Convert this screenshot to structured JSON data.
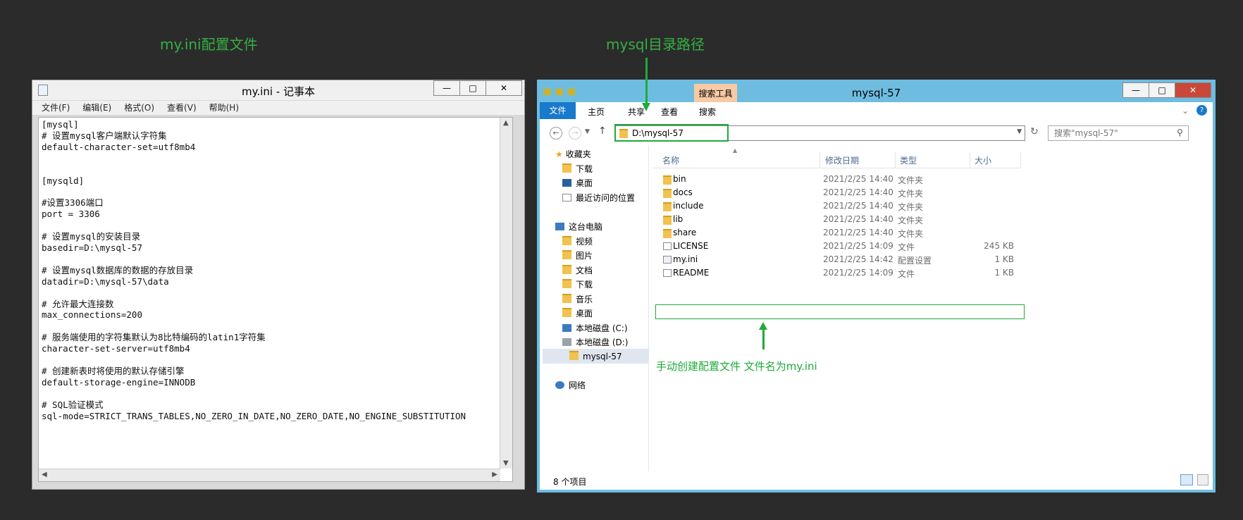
{
  "captions": {
    "notepad": "my.ini配置文件",
    "explorer": "mysql目录路径"
  },
  "notepad": {
    "title": "my.ini - 记事本",
    "menu": [
      "文件(F)",
      "编辑(E)",
      "格式(O)",
      "查看(V)",
      "帮助(H)"
    ],
    "content": "[mysql]\n# 设置mysql客户端默认字符集\ndefault-character-set=utf8mb4\n\n\n[mysqld]\n\n#设置3306端口\nport = 3306\n\n# 设置mysql的安装目录\nbasedir=D:\\mysql-57\n\n# 设置mysql数据库的数据的存放目录\ndatadir=D:\\mysql-57\\data\n\n# 允许最大连接数\nmax_connections=200\n\n# 服务端使用的字符集默认为8比特编码的latin1字符集\ncharacter-set-server=utf8mb4\n\n# 创建新表时将使用的默认存储引擎\ndefault-storage-engine=INNODB\n\n# SQL验证模式\nsql-mode=STRICT_TRANS_TABLES,NO_ZERO_IN_DATE,NO_ZERO_DATE,NO_ENGINE_SUBSTITUTION"
  },
  "explorer": {
    "title": "mysql-57",
    "context_tab": "搜索工具",
    "tabs": [
      "文件",
      "主页",
      "共享",
      "查看",
      "搜索"
    ],
    "address": "D:\\mysql-57",
    "search_placeholder": "搜索\"mysql-57\"",
    "nav": {
      "favorites": "收藏夹",
      "fav_items": [
        "下载",
        "桌面",
        "最近访问的位置"
      ],
      "this_pc": "这台电脑",
      "pc_items": [
        "视频",
        "图片",
        "文档",
        "下载",
        "音乐",
        "桌面",
        "本地磁盘 (C:)",
        "本地磁盘 (D:)",
        "mysql-57"
      ],
      "network": "网络"
    },
    "columns": [
      "名称",
      "修改日期",
      "类型",
      "大小"
    ],
    "files": [
      {
        "name": "bin",
        "date": "2021/2/25 14:40",
        "type": "文件夹",
        "size": ""
      },
      {
        "name": "docs",
        "date": "2021/2/25 14:40",
        "type": "文件夹",
        "size": ""
      },
      {
        "name": "include",
        "date": "2021/2/25 14:40",
        "type": "文件夹",
        "size": ""
      },
      {
        "name": "lib",
        "date": "2021/2/25 14:40",
        "type": "文件夹",
        "size": ""
      },
      {
        "name": "share",
        "date": "2021/2/25 14:40",
        "type": "文件夹",
        "size": ""
      },
      {
        "name": "LICENSE",
        "date": "2021/2/25 14:09",
        "type": "文件",
        "size": "245 KB"
      },
      {
        "name": "my.ini",
        "date": "2021/2/25 14:42",
        "type": "配置设置",
        "size": "1 KB"
      },
      {
        "name": "README",
        "date": "2021/2/25 14:09",
        "type": "文件",
        "size": "1 KB"
      }
    ],
    "annotation": "手动创建配置文件 文件名为my.ini",
    "status": "8 个项目"
  },
  "colors": {
    "annotation": "#1faa3a",
    "titlebar": "#6ebde0",
    "file_tab": "#1979ca"
  }
}
